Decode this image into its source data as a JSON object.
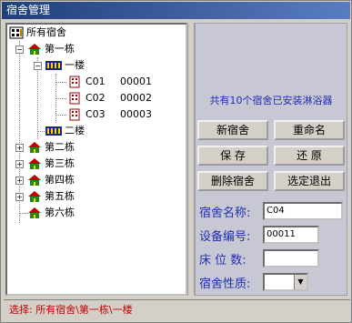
{
  "window": {
    "title": "宿舍管理"
  },
  "tree": {
    "root": "所有宿舍",
    "buildings": [
      {
        "label": "第一栋",
        "toggle": "−"
      },
      {
        "label": "第二栋",
        "toggle": "+"
      },
      {
        "label": "第三栋",
        "toggle": "+"
      },
      {
        "label": "第四栋",
        "toggle": "+"
      },
      {
        "label": "第五栋",
        "toggle": "+"
      },
      {
        "label": "第六栋",
        "toggle": ""
      }
    ],
    "floors": [
      {
        "label": "一楼",
        "toggle": "−"
      },
      {
        "label": "二楼",
        "toggle": ""
      }
    ],
    "rooms": [
      {
        "code": "C01",
        "number": "00001"
      },
      {
        "code": "C02",
        "number": "00002"
      },
      {
        "code": "C03",
        "number": "00003"
      }
    ]
  },
  "info": {
    "text": "共有10个宿舍已安装淋浴器"
  },
  "buttons": {
    "new": "新宿舍",
    "rename": "重命名",
    "save": "保 存",
    "restore": "还 原",
    "delete": "删除宿舍",
    "select_exit": "选定退出"
  },
  "form": {
    "name_label": "宿舍名称:",
    "name_value": "C04",
    "device_label": "设备编号:",
    "device_value": "00011",
    "beds_label": "床 位 数:",
    "beds_value": "",
    "type_label": "宿舍性质:",
    "type_value": ""
  },
  "status": {
    "text": "选择:  所有宿舍\\第一栋\\一楼"
  },
  "colors": {
    "title_bar": "#1f3f7a",
    "accent_text": "#1f2fb0",
    "status_text": "#c00000"
  }
}
